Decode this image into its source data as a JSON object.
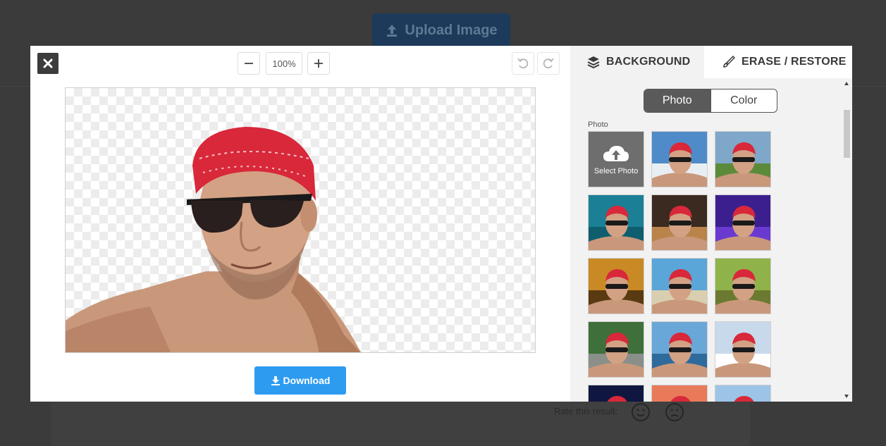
{
  "background_page": {
    "upload_label": "Upload Image",
    "rate_label": "Rate this result:"
  },
  "editor": {
    "zoom_level": "100%",
    "download_label": "Download"
  },
  "panel": {
    "tabs": [
      {
        "label": "BACKGROUND",
        "icon": "layers-icon"
      },
      {
        "label": "ERASE / RESTORE",
        "icon": "brush-icon"
      }
    ],
    "mode": {
      "photo": "Photo",
      "color": "Color",
      "selected": "Photo"
    },
    "section_label": "Photo",
    "select_photo_label": "Select Photo",
    "thumbnails": [
      {
        "name": "bg-thumb-ski-resort",
        "sky": "#4f8bc9",
        "ground": "#e9eef3"
      },
      {
        "name": "bg-thumb-mountain-valley",
        "sky": "#7fa7c9",
        "ground": "#5b8a3a"
      },
      {
        "name": "bg-thumb-teal-wall",
        "sky": "#1b7f95",
        "ground": "#0f5e70"
      },
      {
        "name": "bg-thumb-night-lights",
        "sky": "#3b2a20",
        "ground": "#b9834a"
      },
      {
        "name": "bg-thumb-purple-lasers",
        "sky": "#3b1f8f",
        "ground": "#6a3ad0"
      },
      {
        "name": "bg-thumb-autumn-forest",
        "sky": "#c98a25",
        "ground": "#5a3a10"
      },
      {
        "name": "bg-thumb-beach-sea",
        "sky": "#5aa6d8",
        "ground": "#d9cfb0"
      },
      {
        "name": "bg-thumb-garden-pavilion",
        "sky": "#8fb34a",
        "ground": "#6b7a30"
      },
      {
        "name": "bg-thumb-forest-road",
        "sky": "#3f6f3a",
        "ground": "#8a8f8a"
      },
      {
        "name": "bg-thumb-golden-gate",
        "sky": "#6aa7d9",
        "ground": "#2f6a9c"
      },
      {
        "name": "bg-thumb-cloud-sky",
        "sky": "#c9d9ec",
        "ground": "#ffffff"
      },
      {
        "name": "bg-thumb-dark-blue",
        "sky": "#0f1740",
        "ground": "#1b2b6a"
      },
      {
        "name": "bg-thumb-pink-bokeh",
        "sky": "#e87a5a",
        "ground": "#c94a4a"
      },
      {
        "name": "bg-thumb-light-sky",
        "sky": "#9cc4e6",
        "ground": "#dceaf6"
      }
    ]
  },
  "colors": {
    "accent": "#2d9cf0",
    "overlay": "#3b3b3b",
    "segment_active": "#5a5a5a"
  }
}
